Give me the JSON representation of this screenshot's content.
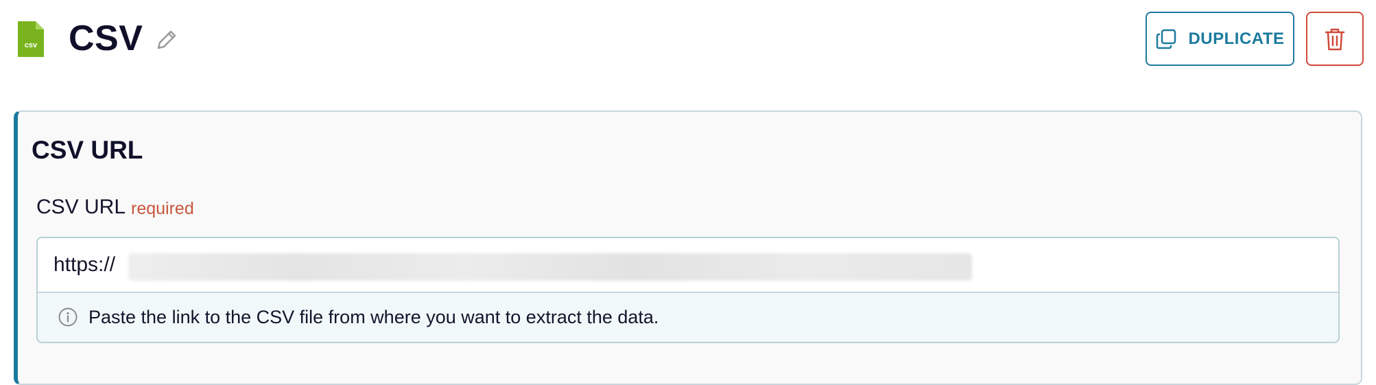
{
  "header": {
    "file_badge": "csv",
    "title": "CSV",
    "duplicate_label": "DUPLICATE"
  },
  "card": {
    "title": "CSV URL",
    "field": {
      "label": "CSV URL",
      "required_text": "required",
      "value": "https://",
      "hint": "Paste the link to the CSV file from where you want to extract the data."
    }
  },
  "icons": {
    "file": "csv-file-icon",
    "edit": "pencil-icon",
    "duplicate": "copy-icon",
    "delete": "trash-icon",
    "info": "info-icon"
  },
  "colors": {
    "accent": "#1b7a9e",
    "danger": "#d0493a",
    "required": "#c8553d",
    "file_green": "#79b41e"
  }
}
